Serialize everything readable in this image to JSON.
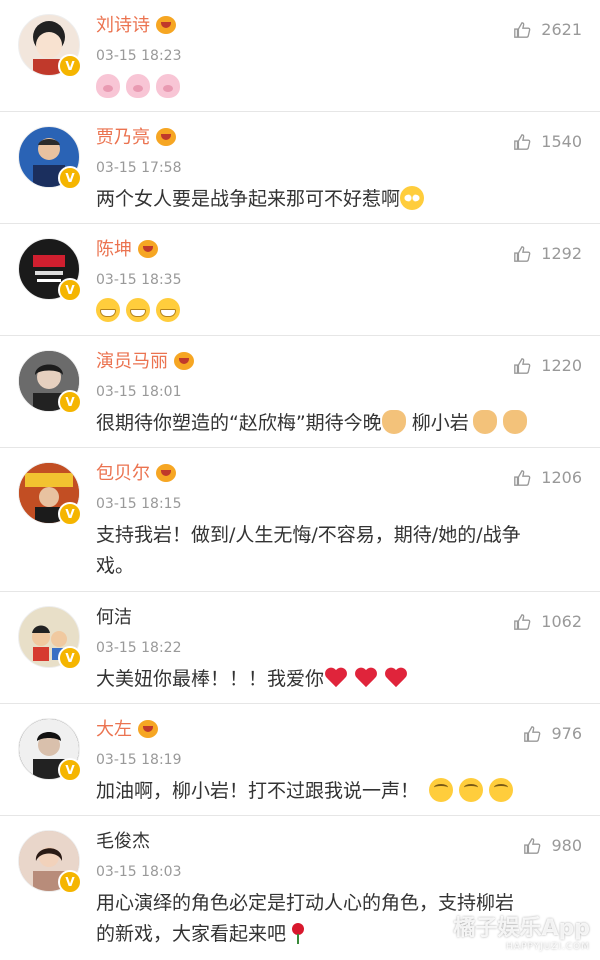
{
  "comments": [
    {
      "name": "刘诗诗",
      "vip": true,
      "verified": true,
      "time": "03-15 18:23",
      "likes": "2621",
      "text": "",
      "emoji": [
        "pig",
        "pig",
        "pig"
      ],
      "avatar_color": "#f2e6dc"
    },
    {
      "name": "贾乃亮",
      "vip": true,
      "verified": true,
      "time": "03-15 17:58",
      "likes": "1540",
      "text": "两个女人要是战争起来那可不好惹啊",
      "emoji": [
        "flush"
      ],
      "avatar_color": "#2a63b5"
    },
    {
      "name": "陈坤",
      "vip": true,
      "verified": true,
      "time": "03-15 18:35",
      "likes": "1292",
      "text": "",
      "emoji": [
        "grin",
        "grin",
        "grin"
      ],
      "avatar_color": "#1a1a1a"
    },
    {
      "name": "演员马丽",
      "vip": true,
      "verified": true,
      "time": "03-15 18:01",
      "likes": "1220",
      "text": "很期待你塑造的“赵欣梅”期待今晚",
      "text2": "柳小岩",
      "emoji": [
        "hand"
      ],
      "emoji2": [
        "hand",
        "hand"
      ],
      "avatar_color": "#555555"
    },
    {
      "name": "包贝尔",
      "vip": true,
      "verified": true,
      "time": "03-15 18:15",
      "likes": "1206",
      "text": "支持我岩！做到/人生无悔/不容易，期待/她的/战争",
      "text_line2": "戏。",
      "emoji": [],
      "avatar_color": "#b8451e"
    },
    {
      "name": "何洁",
      "vip": false,
      "verified": true,
      "time": "03-15 18:22",
      "likes": "1062",
      "text": "大美妞你最棒！！！我爱你",
      "emoji": [
        "heart",
        "heart",
        "heart"
      ],
      "avatar_color": "#e8dfc8"
    },
    {
      "name": "大左",
      "vip": true,
      "verified": true,
      "time": "03-15 18:19",
      "likes": "976",
      "text": "加油啊，柳小岩！打不过跟我说一声！",
      "emoji": [
        "shy",
        "shy",
        "shy"
      ],
      "avatar_color": "#3a3a3a"
    },
    {
      "name": "毛俊杰",
      "vip": false,
      "verified": true,
      "time": "03-15 18:03",
      "likes": "980",
      "text": "用心演绎的角色必定是打动人心的角色，支持柳岩",
      "text_line2": "的新戏，大家看起来吧",
      "emoji": [],
      "emoji_line2": [
        "rose"
      ],
      "avatar_color": "#d9b8a8"
    }
  ],
  "watermark": {
    "main": "橘子娱乐App",
    "sub": "HAPPYJUZI.COM"
  },
  "colors": {
    "name_vip": "#eb7350",
    "time": "#999999",
    "divider": "#e6e6e6",
    "badge": "#f5b500"
  },
  "icons": {
    "like": "thumb-up-icon",
    "verified": "verified-badge-icon",
    "vip": "vip-crown-icon"
  }
}
